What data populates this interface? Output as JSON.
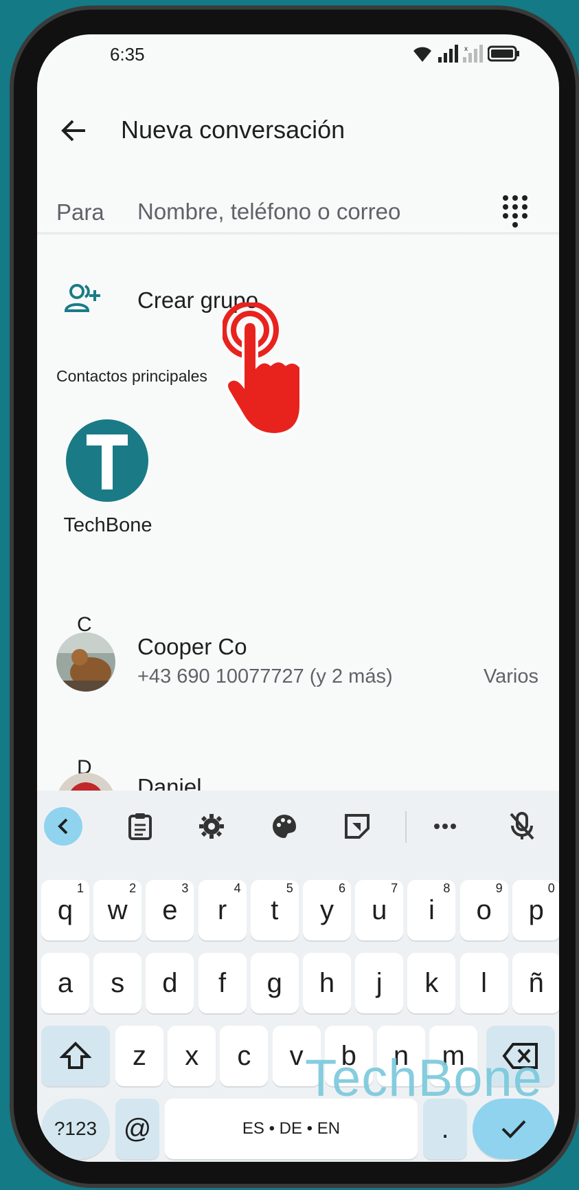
{
  "status": {
    "time": "6:35"
  },
  "appbar": {
    "title": "Nueva conversación"
  },
  "to_field": {
    "label": "Para",
    "placeholder": "Nombre, teléfono o correo"
  },
  "create_group": {
    "label": "Crear grupo"
  },
  "top_contacts": {
    "heading": "Contactos principales",
    "items": [
      {
        "name": "TechBone",
        "initial": "T"
      }
    ]
  },
  "sections": [
    {
      "letter": "C",
      "contacts": [
        {
          "name": "Cooper Co",
          "phone": "+43 690 10077727 (y 2 más)",
          "tag": "Varios"
        }
      ]
    },
    {
      "letter": "D",
      "contacts": [
        {
          "name": "Daniel"
        }
      ]
    }
  ],
  "keyboard": {
    "row1": [
      {
        "k": "q",
        "s": "1"
      },
      {
        "k": "w",
        "s": "2"
      },
      {
        "k": "e",
        "s": "3"
      },
      {
        "k": "r",
        "s": "4"
      },
      {
        "k": "t",
        "s": "5"
      },
      {
        "k": "y",
        "s": "6"
      },
      {
        "k": "u",
        "s": "7"
      },
      {
        "k": "i",
        "s": "8"
      },
      {
        "k": "o",
        "s": "9"
      },
      {
        "k": "p",
        "s": "0"
      }
    ],
    "row2": [
      "a",
      "s",
      "d",
      "f",
      "g",
      "h",
      "j",
      "k",
      "l",
      "ñ"
    ],
    "row3": [
      "z",
      "x",
      "c",
      "v",
      "b",
      "n",
      "m"
    ],
    "sym_label": "?123",
    "at_label": "@",
    "space_label": "ES • DE • EN",
    "period_label": "."
  },
  "watermark": "TechBone",
  "colors": {
    "accent": "#1a7b87",
    "key_mod": "#d4e7f0",
    "enter": "#8fd3ef",
    "pointer": "#e8231e"
  }
}
